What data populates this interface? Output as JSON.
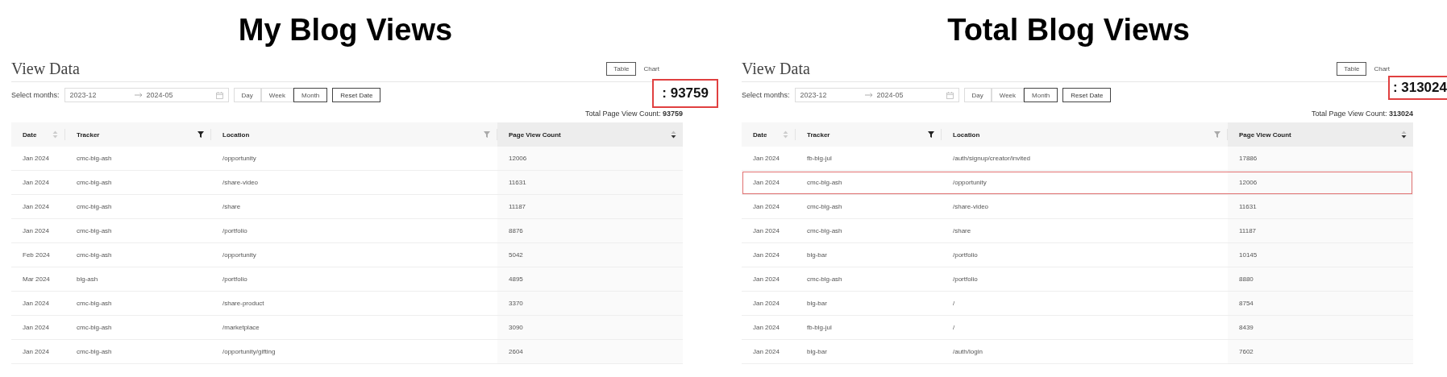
{
  "panels": [
    {
      "heading": "My Blog Views",
      "title": "View Data",
      "view_tabs": [
        {
          "label": "Table",
          "selected": true
        },
        {
          "label": "Chart",
          "selected": false
        }
      ],
      "callout": ": 93759",
      "months_label": "Select months:",
      "date_from": "2023-12",
      "date_to": "2024-05",
      "periods": [
        {
          "label": "Day",
          "selected": false
        },
        {
          "label": "Week",
          "selected": false
        },
        {
          "label": "Month",
          "selected": true
        }
      ],
      "reset_button": "Reset Date",
      "total": "Total Page View Count: **93759**",
      "columns": [
        {
          "label": "Date",
          "kind": "sort",
          "active": false
        },
        {
          "label": "Tracker",
          "kind": "filter",
          "active": true
        },
        {
          "label": "Location",
          "kind": "filter",
          "active": false
        },
        {
          "label": "Page View Count",
          "kind": "sort",
          "active": true
        }
      ],
      "rows": [
        {
          "cells": [
            "Jan 2024",
            "cmc-blg-ash",
            "/opportunity",
            "12006"
          ],
          "highlighted": false
        },
        {
          "cells": [
            "Jan 2024",
            "cmc-blg-ash",
            "/share-video",
            "11631"
          ],
          "highlighted": false
        },
        {
          "cells": [
            "Jan 2024",
            "cmc-blg-ash",
            "/share",
            "11187"
          ],
          "highlighted": false
        },
        {
          "cells": [
            "Jan 2024",
            "cmc-blg-ash",
            "/portfolio",
            "8876"
          ],
          "highlighted": false
        },
        {
          "cells": [
            "Feb 2024",
            "cmc-blg-ash",
            "/opportunity",
            "5042"
          ],
          "highlighted": false
        },
        {
          "cells": [
            "Mar 2024",
            "blg-ash",
            "/portfolio",
            "4895"
          ],
          "highlighted": false
        },
        {
          "cells": [
            "Jan 2024",
            "cmc-blg-ash",
            "/share-product",
            "3370"
          ],
          "highlighted": false
        },
        {
          "cells": [
            "Jan 2024",
            "cmc-blg-ash",
            "/marketplace",
            "3090"
          ],
          "highlighted": false
        },
        {
          "cells": [
            "Jan 2024",
            "cmc-blg-ash",
            "/opportunity/gifting",
            "2604"
          ],
          "highlighted": false
        }
      ]
    },
    {
      "heading": "Total Blog Views",
      "title": "View Data",
      "view_tabs": [
        {
          "label": "Table",
          "selected": true
        },
        {
          "label": "Chart",
          "selected": false
        }
      ],
      "callout": ": 313024",
      "months_label": "Select months:",
      "date_from": "2023-12",
      "date_to": "2024-05",
      "periods": [
        {
          "label": "Day",
          "selected": false
        },
        {
          "label": "Week",
          "selected": false
        },
        {
          "label": "Month",
          "selected": true
        }
      ],
      "reset_button": "Reset Date",
      "total": "Total Page View Count: **313024**",
      "columns": [
        {
          "label": "Date",
          "kind": "sort",
          "active": false
        },
        {
          "label": "Tracker",
          "kind": "filter",
          "active": true
        },
        {
          "label": "Location",
          "kind": "filter",
          "active": false
        },
        {
          "label": "Page View Count",
          "kind": "sort",
          "active": true
        }
      ],
      "rows": [
        {
          "cells": [
            "Jan 2024",
            "fb-blg-jul",
            "/auth/signup/creator/invited",
            "17886"
          ],
          "highlighted": false
        },
        {
          "cells": [
            "Jan 2024",
            "cmc-blg-ash",
            "/opportunity",
            "12006"
          ],
          "highlighted": true
        },
        {
          "cells": [
            "Jan 2024",
            "cmc-blg-ash",
            "/share-video",
            "11631"
          ],
          "highlighted": false
        },
        {
          "cells": [
            "Jan 2024",
            "cmc-blg-ash",
            "/share",
            "11187"
          ],
          "highlighted": false
        },
        {
          "cells": [
            "Jan 2024",
            "blg-bar",
            "/portfolio",
            "10145"
          ],
          "highlighted": false
        },
        {
          "cells": [
            "Jan 2024",
            "cmc-blg-ash",
            "/portfolio",
            "8880"
          ],
          "highlighted": false
        },
        {
          "cells": [
            "Jan 2024",
            "blg-bar",
            "/",
            "8754"
          ],
          "highlighted": false
        },
        {
          "cells": [
            "Jan 2024",
            "fb-blg-jul",
            "/",
            "8439"
          ],
          "highlighted": false
        },
        {
          "cells": [
            "Jan 2024",
            "blg-bar",
            "/auth/login",
            "7602"
          ],
          "highlighted": false
        }
      ]
    }
  ]
}
